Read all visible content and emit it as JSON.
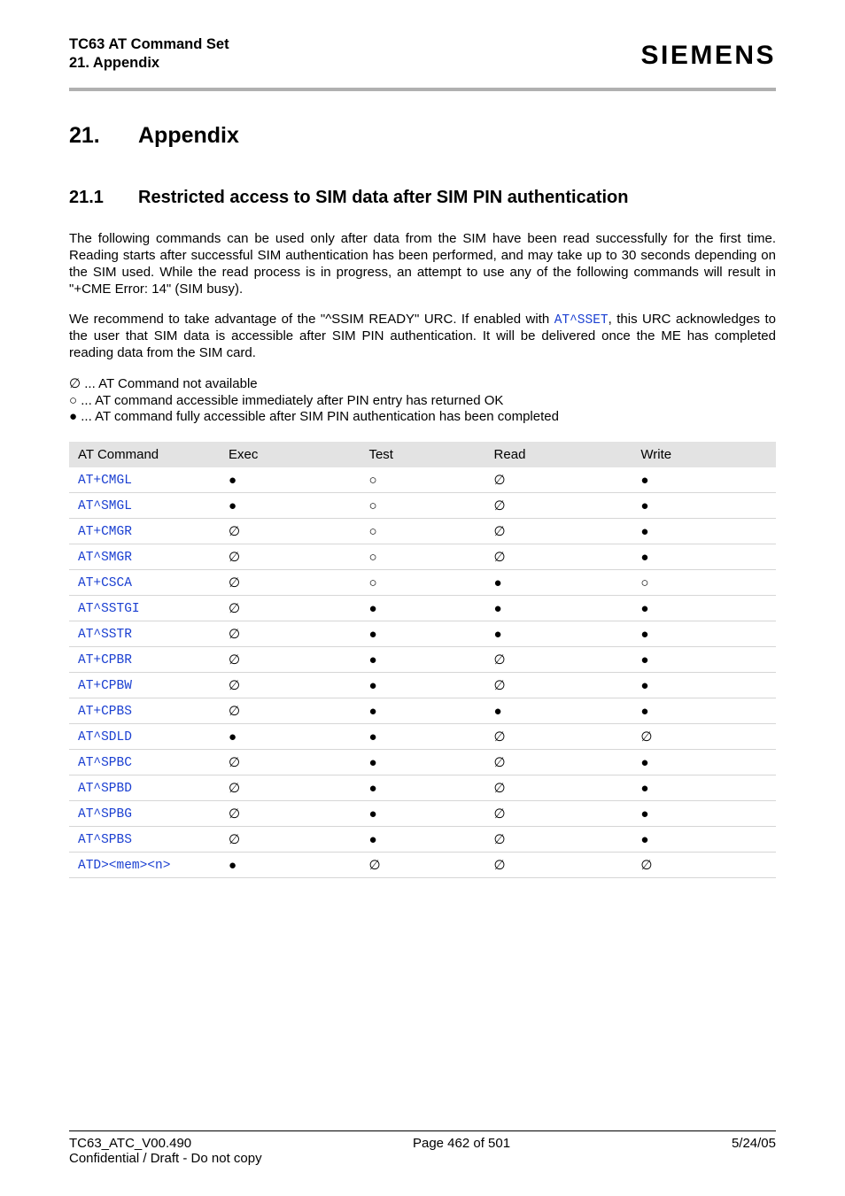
{
  "header": {
    "title_line1": "TC63 AT Command Set",
    "title_line2": "21. Appendix",
    "brand": "SIEMENS"
  },
  "h1": {
    "num": "21.",
    "text": "Appendix"
  },
  "h2": {
    "num": "21.1",
    "text": "Restricted access to SIM data after SIM PIN authentication"
  },
  "para1": "The following commands can be used only after data from the SIM have been read successfully for the first time. Reading starts after successful SIM authentication has been performed, and may take up to 30 seconds depending on the SIM used. While the read process is in progress, an attempt to use any of the following commands will result in \"+CME Error: 14\" (SIM busy).",
  "para2_pre": "We recommend to take advantage of the \"^SSIM READY\" URC. If enabled with ",
  "para2_link": "AT^SSET",
  "para2_post": ", this URC acknowledges to the user that SIM data is accessible after SIM PIN authentication. It will be delivered once the ME has completed reading data from the SIM card.",
  "legend": {
    "na_sym": "∅",
    "na_text": " ... AT Command not available",
    "imm_sym": "○",
    "imm_text": " ... AT command accessible immediately after PIN entry has returned OK",
    "full_sym": "●",
    "full_text": " ... AT command fully accessible after SIM PIN authentication has been completed"
  },
  "table": {
    "headers": [
      "AT Command",
      "Exec",
      "Test",
      "Read",
      "Write"
    ],
    "rows": [
      {
        "cmd": "AT+CMGL",
        "exec": "●",
        "test": "○",
        "read": "∅",
        "write": "●"
      },
      {
        "cmd": "AT^SMGL",
        "exec": "●",
        "test": "○",
        "read": "∅",
        "write": "●"
      },
      {
        "cmd": "AT+CMGR",
        "exec": "∅",
        "test": "○",
        "read": "∅",
        "write": "●"
      },
      {
        "cmd": "AT^SMGR",
        "exec": "∅",
        "test": "○",
        "read": "∅",
        "write": "●"
      },
      {
        "cmd": "AT+CSCA",
        "exec": "∅",
        "test": "○",
        "read": "●",
        "write": "○"
      },
      {
        "cmd": "AT^SSTGI",
        "exec": "∅",
        "test": "●",
        "read": "●",
        "write": "●"
      },
      {
        "cmd": "AT^SSTR",
        "exec": "∅",
        "test": "●",
        "read": "●",
        "write": "●"
      },
      {
        "cmd": "AT+CPBR",
        "exec": "∅",
        "test": "●",
        "read": "∅",
        "write": "●"
      },
      {
        "cmd": "AT+CPBW",
        "exec": "∅",
        "test": "●",
        "read": "∅",
        "write": "●"
      },
      {
        "cmd": "AT+CPBS",
        "exec": "∅",
        "test": "●",
        "read": "●",
        "write": "●"
      },
      {
        "cmd": "AT^SDLD",
        "exec": "●",
        "test": "●",
        "read": "∅",
        "write": "∅"
      },
      {
        "cmd": "AT^SPBC",
        "exec": "∅",
        "test": "●",
        "read": "∅",
        "write": "●"
      },
      {
        "cmd": "AT^SPBD",
        "exec": "∅",
        "test": "●",
        "read": "∅",
        "write": "●"
      },
      {
        "cmd": "AT^SPBG",
        "exec": "∅",
        "test": "●",
        "read": "∅",
        "write": "●"
      },
      {
        "cmd": "AT^SPBS",
        "exec": "∅",
        "test": "●",
        "read": "∅",
        "write": "●"
      },
      {
        "cmd": "ATD><mem><n>",
        "exec": "●",
        "test": "∅",
        "read": "∅",
        "write": "∅"
      }
    ]
  },
  "footer": {
    "left": "TC63_ATC_V00.490",
    "center": "Page 462 of 501",
    "right": "5/24/05",
    "sub": "Confidential / Draft - Do not copy"
  }
}
